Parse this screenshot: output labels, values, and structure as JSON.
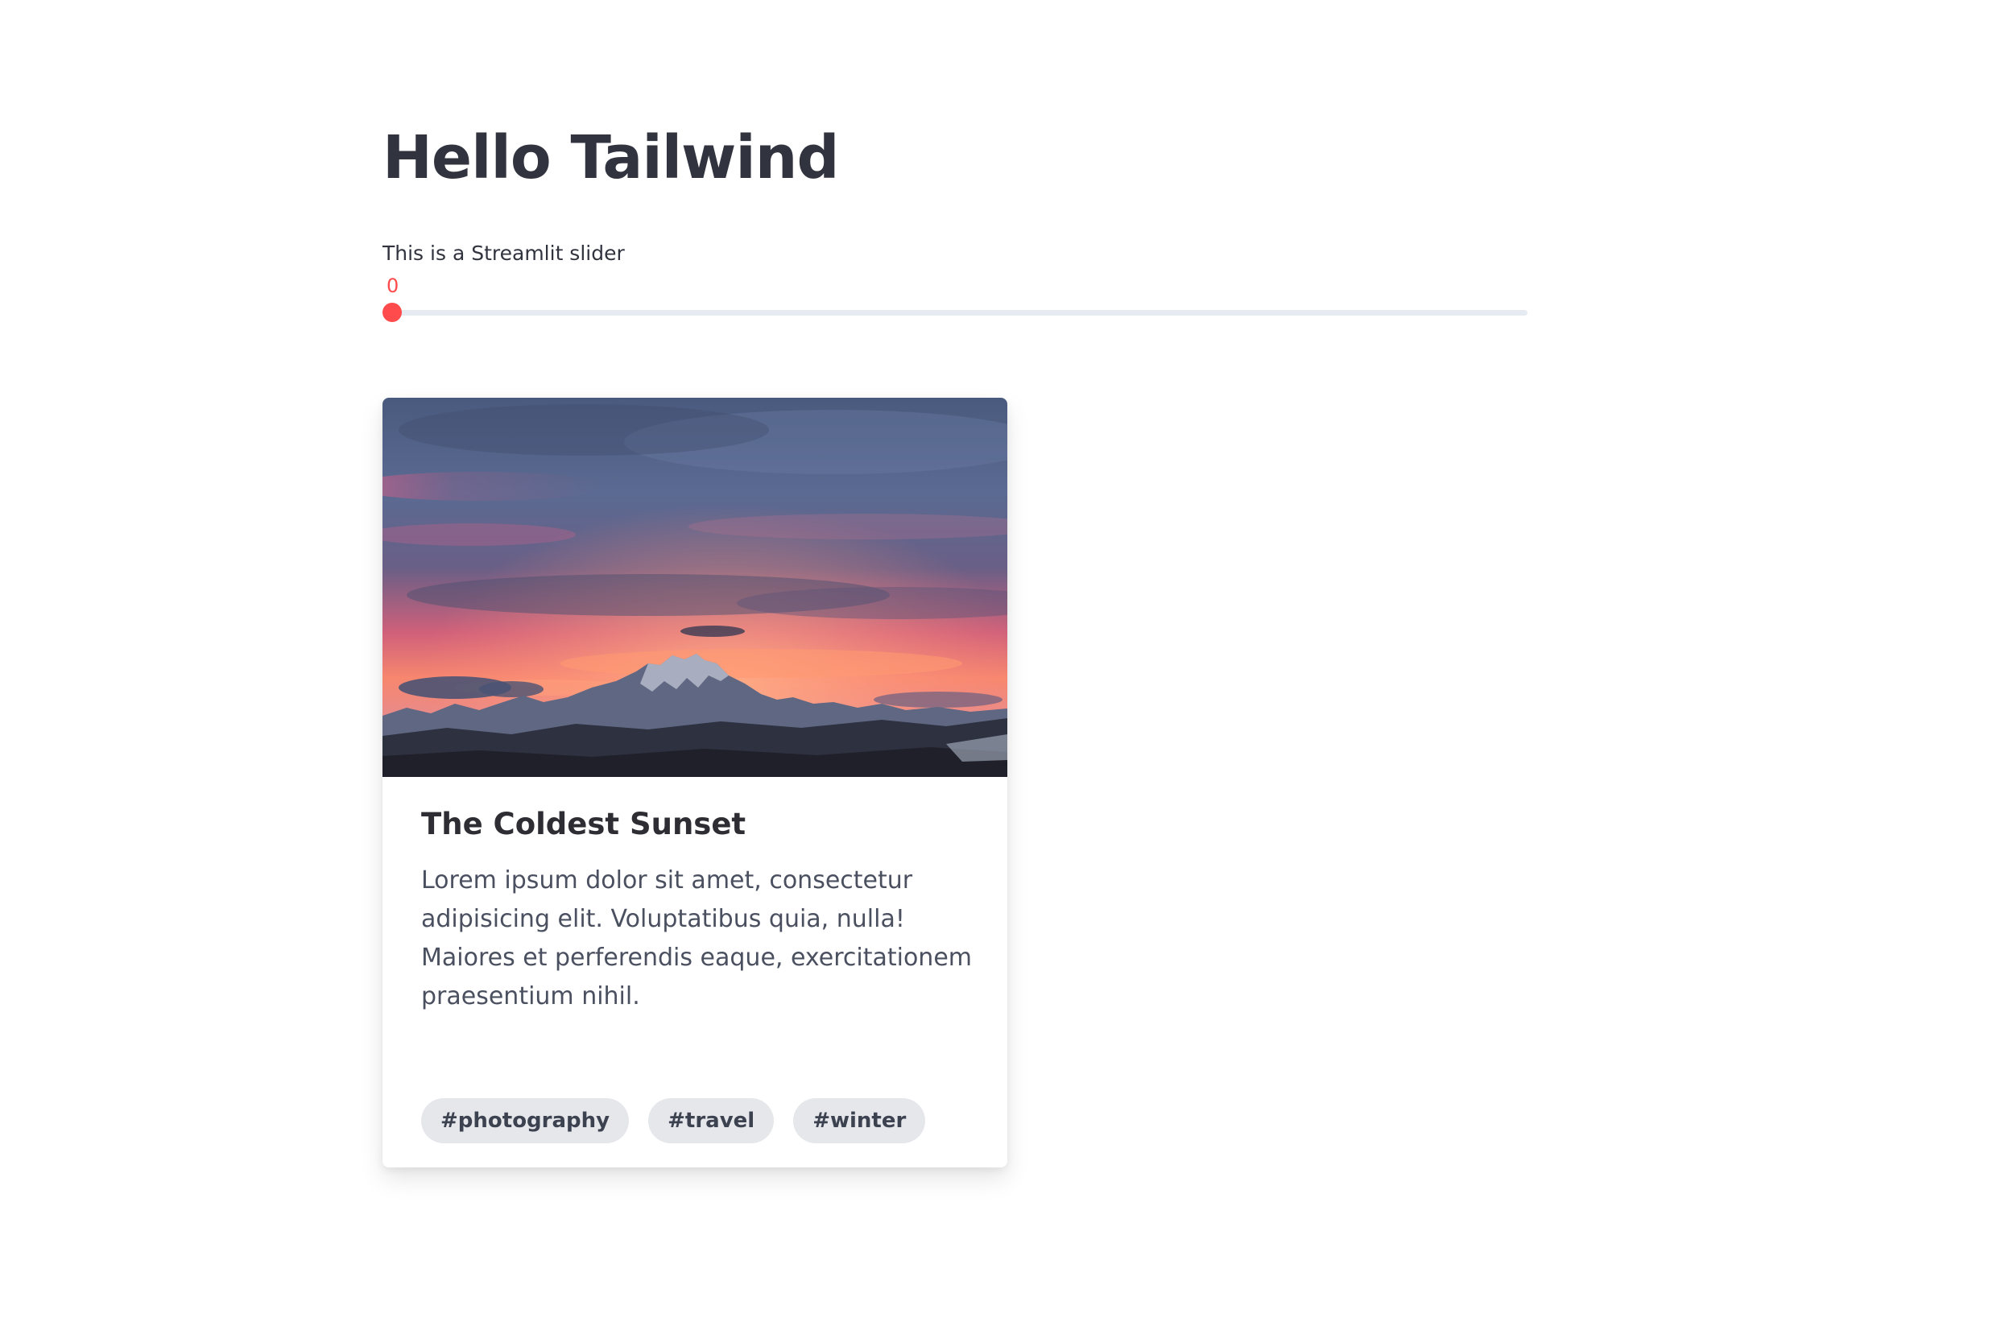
{
  "page": {
    "title": "Hello Tailwind"
  },
  "slider": {
    "label": "This is a Streamlit slider",
    "value": 0,
    "value_text": "0",
    "fraction": 0,
    "accent_color": "#ff4b4b",
    "track_color": "#e6eaf1"
  },
  "card": {
    "image_alt": "Sunset over snowy mountains",
    "title": "The Coldest Sunset",
    "text": "Lorem ipsum dolor sit amet, consectetur adipisicing elit. Voluptatibus quia, nulla! Maiores et perferendis eaque, exercitationem praesentium nihil.",
    "tags": [
      "#photography",
      "#travel",
      "#winter"
    ]
  }
}
